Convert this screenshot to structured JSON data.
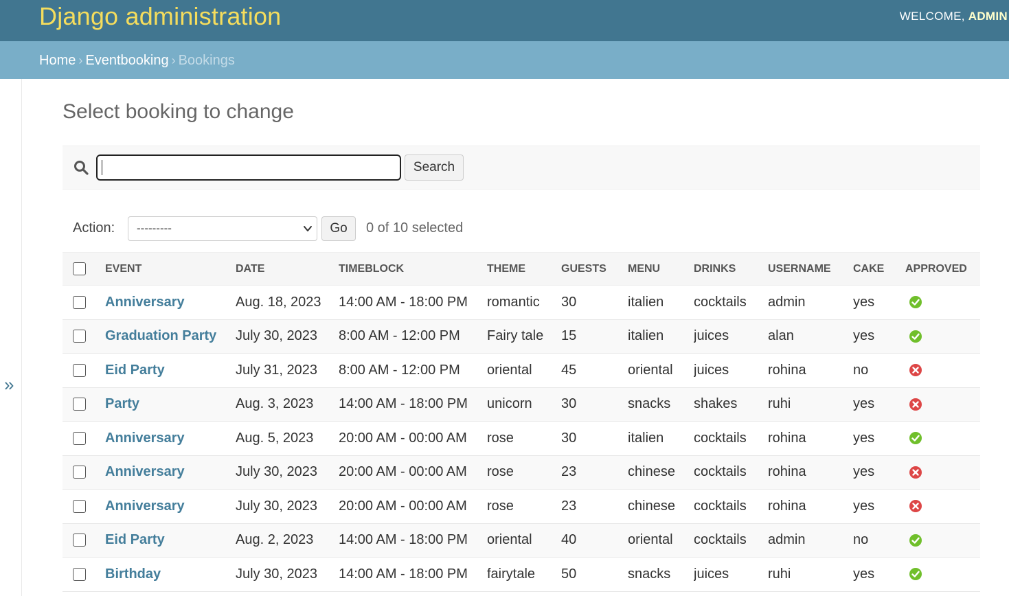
{
  "header": {
    "site_name": "Django administration",
    "welcome": "Welcome,",
    "user": "admin"
  },
  "breadcrumbs": {
    "home": "Home",
    "app": "Eventbooking",
    "current": "Bookings",
    "separator": "›"
  },
  "sidebar_toggle": "»",
  "page_title": "Select booking to change",
  "search": {
    "value": "",
    "button_label": "Search"
  },
  "actions": {
    "label": "Action:",
    "selected_option": "---------",
    "go_label": "Go",
    "selected_count": "0 of 10 selected"
  },
  "table": {
    "columns": [
      "Event",
      "Date",
      "Timeblock",
      "Theme",
      "Guests",
      "Menu",
      "Drinks",
      "Username",
      "Cake",
      "Approved"
    ],
    "rows": [
      {
        "event": "Anniversary",
        "date": "Aug. 18, 2023",
        "timeblock": "14:00 AM - 18:00 PM",
        "theme": "romantic",
        "guests": "30",
        "menu": "italien",
        "drinks": "cocktails",
        "username": "admin",
        "cake": "yes",
        "approved": true
      },
      {
        "event": "Graduation Party",
        "date": "July 30, 2023",
        "timeblock": "8:00 AM - 12:00 PM",
        "theme": "Fairy tale",
        "guests": "15",
        "menu": "italien",
        "drinks": "juices",
        "username": "alan",
        "cake": "yes",
        "approved": true
      },
      {
        "event": "Eid Party",
        "date": "July 31, 2023",
        "timeblock": "8:00 AM - 12:00 PM",
        "theme": "oriental",
        "guests": "45",
        "menu": "oriental",
        "drinks": "juices",
        "username": "rohina",
        "cake": "no",
        "approved": false
      },
      {
        "event": "Party",
        "date": "Aug. 3, 2023",
        "timeblock": "14:00 AM - 18:00 PM",
        "theme": "unicorn",
        "guests": "30",
        "menu": "snacks",
        "drinks": "shakes",
        "username": "ruhi",
        "cake": "yes",
        "approved": false
      },
      {
        "event": "Anniversary",
        "date": "Aug. 5, 2023",
        "timeblock": "20:00 AM - 00:00 AM",
        "theme": "rose",
        "guests": "30",
        "menu": "italien",
        "drinks": "cocktails",
        "username": "rohina",
        "cake": "yes",
        "approved": true
      },
      {
        "event": "Anniversary",
        "date": "July 30, 2023",
        "timeblock": "20:00 AM - 00:00 AM",
        "theme": "rose",
        "guests": "23",
        "menu": "chinese",
        "drinks": "cocktails",
        "username": "rohina",
        "cake": "yes",
        "approved": false
      },
      {
        "event": "Anniversary",
        "date": "July 30, 2023",
        "timeblock": "20:00 AM - 00:00 AM",
        "theme": "rose",
        "guests": "23",
        "menu": "chinese",
        "drinks": "cocktails",
        "username": "rohina",
        "cake": "yes",
        "approved": false
      },
      {
        "event": "Eid Party",
        "date": "Aug. 2, 2023",
        "timeblock": "14:00 AM - 18:00 PM",
        "theme": "oriental",
        "guests": "40",
        "menu": "oriental",
        "drinks": "cocktails",
        "username": "admin",
        "cake": "no",
        "approved": true
      },
      {
        "event": "Birthday",
        "date": "July 30, 2023",
        "timeblock": "14:00 AM - 18:00 PM",
        "theme": "fairytale",
        "guests": "50",
        "menu": "snacks",
        "drinks": "juices",
        "username": "ruhi",
        "cake": "yes",
        "approved": true
      }
    ]
  },
  "colors": {
    "header_bg": "#417690",
    "site_name": "#f5dd5d",
    "breadcrumbs_bg": "#79aec8",
    "link": "#447e9b",
    "approved_yes": "#70bf2b",
    "approved_no": "#dd4646"
  },
  "icons": {
    "search": "search-icon",
    "approved_yes": "check-circle-icon",
    "approved_no": "cross-circle-icon",
    "select_arrow": "chevron-down-icon"
  }
}
